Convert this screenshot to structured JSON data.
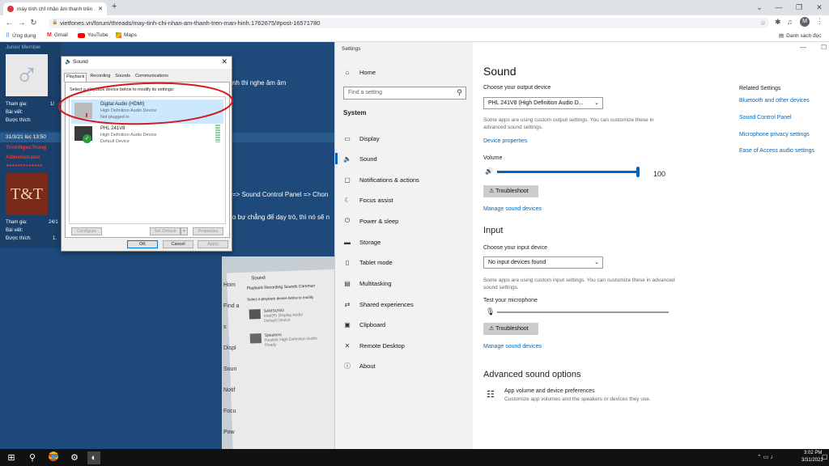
{
  "browser": {
    "tab_title": "máy tính chỉ nhận âm thanh trên ...",
    "new_tab": "+",
    "url": "vietfones.vn/forum/threads/may-tinh-chi-nhan-am-thanh-tren-man-hinh.1762675/#post-16571780",
    "bookmarks": [
      "Ứng dụng",
      "Gmail",
      "YouTube",
      "Maps"
    ],
    "reading_list": "Danh sách đọc",
    "profile_initial": "M"
  },
  "forum": {
    "user1_role": "Junior Member",
    "labels": [
      "Tham gia:",
      "Bài viết:",
      "Được thích:"
    ],
    "user1_values": [
      "1/",
      "",
      ""
    ],
    "post_date": "31/3/21 lúc 13:50",
    "user2_name": "TrinhNgocTrung",
    "user2_role": "Administrator",
    "user2_values": [
      "24/1",
      "",
      "1."
    ],
    "text1": "nh thi nghe âm âm",
    "text2": "=> Sound Control Panel => Chon",
    "text3": "o bự chẳng để dạy trò, thì nó sẽ n"
  },
  "sound_dialog": {
    "title": "Sound",
    "tabs": [
      "Playback",
      "Recording",
      "Sounds",
      "Communications"
    ],
    "instruction": "Select a playback device below to modify its settings:",
    "devices": [
      {
        "name": "Digital Audio (HDMI)",
        "driver": "High Definition Audio Device",
        "status": "Not plugged in"
      },
      {
        "name": "PHL 241V8",
        "driver": "High Definition Audio Device",
        "status": "Default Device"
      }
    ],
    "configure": "Configure",
    "set_default": "Set Default",
    "properties": "Properties",
    "ok": "OK",
    "cancel": "Cancel",
    "apply": "Apply"
  },
  "photo": {
    "sound_title": "Sound",
    "tabs": "Playback  Recording  Sounds  Commun",
    "instruction": "Select a playback device below to modify",
    "dev1_name": "SAMSUNG",
    "dev1_sub": "Intel(R) Display Audio",
    "dev1_status": "Default Device",
    "dev2_name": "Speakers",
    "dev2_sub": "Realtek High Definition Audio",
    "dev2_status": "Ready",
    "side_labels": [
      "Hom",
      "Find a s",
      "Displ",
      "Soun",
      "Notif",
      "Focu",
      "Pow"
    ]
  },
  "settings": {
    "window_title": "Settings",
    "home": "Home",
    "search_placeholder": "Find a setting",
    "section": "System",
    "nav": [
      "Display",
      "Sound",
      "Notifications & actions",
      "Focus assist",
      "Power & sleep",
      "Storage",
      "Tablet mode",
      "Multitasking",
      "Shared experiences",
      "Clipboard",
      "Remote Desktop",
      "About"
    ],
    "heading": "Sound",
    "output_label": "Choose your output device",
    "output_value": "PHL 241V8 (High Definition Audio D...",
    "output_note": "Some apps are using custom output settings. You can customize these in advanced sound settings.",
    "device_properties": "Device properties",
    "volume_label": "Volume",
    "volume_value": "100",
    "volume_level": 1.0,
    "troubleshoot": "Troubleshoot",
    "manage_devices": "Manage sound devices",
    "input_heading": "Input",
    "input_label": "Choose your input device",
    "input_value": "No input devices found",
    "input_note": "Some apps are using custom input settings. You can customize these in advanced sound settings.",
    "test_mic": "Test your microphone",
    "advanced_heading": "Advanced sound options",
    "app_volume_title": "App volume and device preferences",
    "app_volume_desc": "Customize app volumes and the speakers or devices they use.",
    "related_heading": "Related Settings",
    "related_links": [
      "Bluetooth and other devices",
      "Sound Control Panel",
      "Microphone privacy settings",
      "Ease of Access audio settings"
    ]
  },
  "taskbar": {
    "time": "3:02 PM",
    "date": "3/31/2021"
  },
  "colors": {
    "accent": "#0067c0",
    "highlight_circle": "#d01c1c",
    "forum_bg": "#1d4a7a"
  }
}
